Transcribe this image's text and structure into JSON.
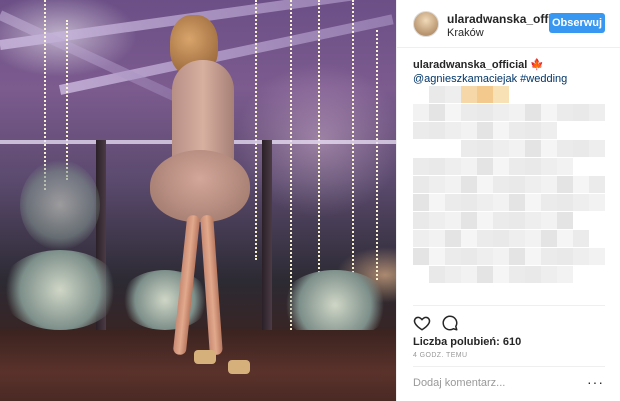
{
  "post": {
    "username": "ularadwanska_offic",
    "location": "Kraków",
    "follow_label": "Obserwuj",
    "caption": {
      "user": "ularadwanska_official",
      "emoji": "🍁",
      "mention": "@agnieszkamaciejak",
      "hashtag": "#wedding"
    },
    "likes_text": "Liczba polubień: 610",
    "time_text": "4 GODZ. TEMU",
    "comment_placeholder": "Dodaj komentarz...",
    "more_glyph": "···"
  },
  "icons": {
    "like": "heart-outline-icon",
    "comment": "speech-bubble-icon",
    "more": "ellipsis-icon"
  },
  "colors": {
    "follow_button": "#3897f0",
    "link": "#003569",
    "muted": "#999999"
  }
}
